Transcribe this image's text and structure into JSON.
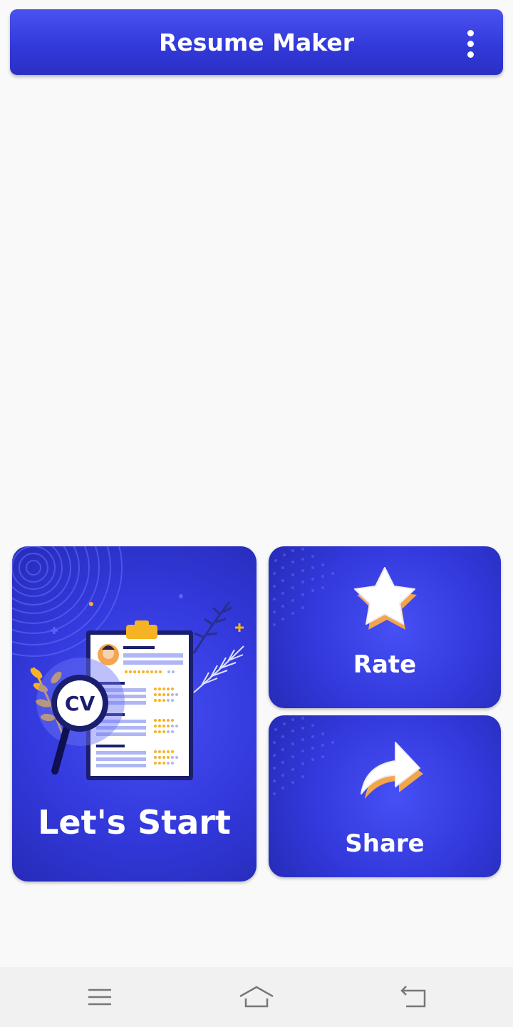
{
  "app": {
    "title": "Resume Maker",
    "menu_icon": "more-vertical-icon"
  },
  "cards": {
    "start": {
      "label": "Let's Start",
      "icon": "cv-document-magnifier-icon"
    },
    "rate": {
      "label": "Rate",
      "icon": "star-icon"
    },
    "share": {
      "label": "Share",
      "icon": "share-arrow-icon"
    }
  },
  "illustration": {
    "magnifier_text": "CV"
  },
  "navbar": {
    "items": [
      {
        "icon": "menu-icon"
      },
      {
        "icon": "home-icon"
      },
      {
        "icon": "back-icon"
      }
    ]
  },
  "colors": {
    "primary": "#3339dc",
    "accent_gold": "#f5b324",
    "background": "#f9f9f9"
  }
}
